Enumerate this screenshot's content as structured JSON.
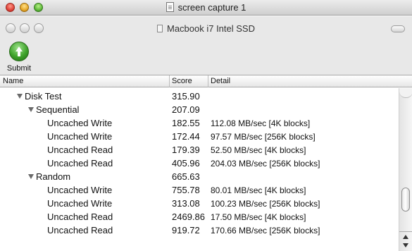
{
  "outer_window": {
    "title": "screen capture 1",
    "icon": "document-icon"
  },
  "inner_window": {
    "title": "Macbook i7 Intel SSD",
    "icon": "document-icon"
  },
  "toolbar": {
    "submit_label": "Submit",
    "submit_icon": "upload-arrow-icon"
  },
  "columns": {
    "name": "Name",
    "score": "Score",
    "detail": "Detail"
  },
  "rows": [
    {
      "name": "Disk Test",
      "score": "315.90",
      "detail": "",
      "level": 0,
      "expandable": true
    },
    {
      "name": "Sequential",
      "score": "207.09",
      "detail": "",
      "level": 1,
      "expandable": true
    },
    {
      "name": "Uncached Write",
      "score": "182.55",
      "detail": "112.08 MB/sec [4K blocks]",
      "level": 2,
      "expandable": false
    },
    {
      "name": "Uncached Write",
      "score": "172.44",
      "detail": "97.57 MB/sec [256K blocks]",
      "level": 2,
      "expandable": false
    },
    {
      "name": "Uncached Read",
      "score": "179.39",
      "detail": "52.50 MB/sec [4K blocks]",
      "level": 2,
      "expandable": false
    },
    {
      "name": "Uncached Read",
      "score": "405.96",
      "detail": "204.03 MB/sec [256K blocks]",
      "level": 2,
      "expandable": false
    },
    {
      "name": "Random",
      "score": "665.63",
      "detail": "",
      "level": 1,
      "expandable": true
    },
    {
      "name": "Uncached Write",
      "score": "755.78",
      "detail": "80.01 MB/sec [4K blocks]",
      "level": 2,
      "expandable": false
    },
    {
      "name": "Uncached Write",
      "score": "313.08",
      "detail": "100.23 MB/sec [256K blocks]",
      "level": 2,
      "expandable": false
    },
    {
      "name": "Uncached Read",
      "score": "2469.86",
      "detail": "17.50 MB/sec [4K blocks]",
      "level": 2,
      "expandable": false
    },
    {
      "name": "Uncached Read",
      "score": "919.72",
      "detail": "170.66 MB/sec [256K blocks]",
      "level": 2,
      "expandable": false
    }
  ]
}
